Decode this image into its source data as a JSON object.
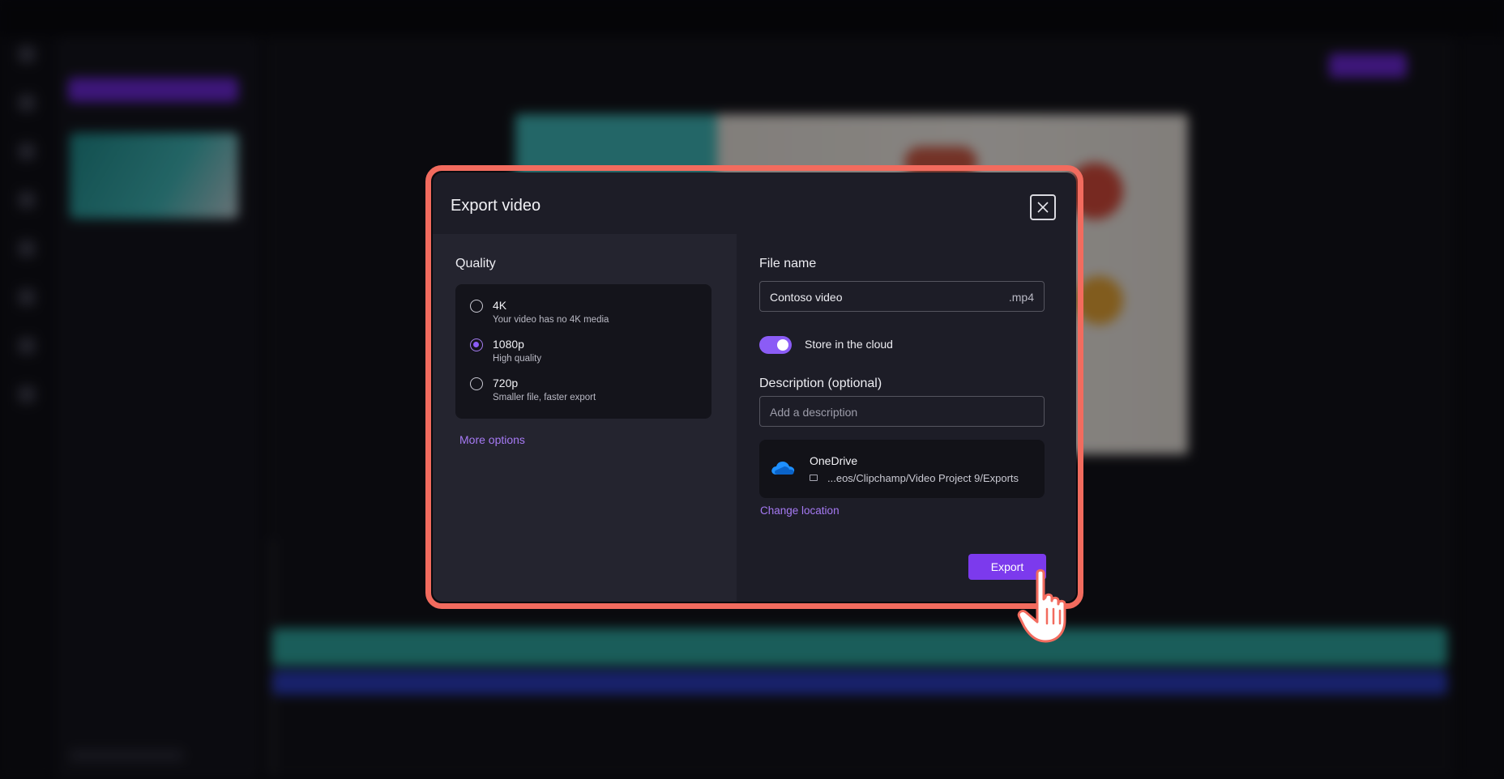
{
  "dialog": {
    "title": "Export video",
    "close_icon": "close-icon"
  },
  "quality": {
    "label": "Quality",
    "selected": "1080p",
    "options": [
      {
        "name": "4K",
        "description": "Your video has no 4K media"
      },
      {
        "name": "1080p",
        "description": "High quality"
      },
      {
        "name": "720p",
        "description": "Smaller file, faster export"
      }
    ],
    "more_options": "More options"
  },
  "file": {
    "label": "File name",
    "value": "Contoso video",
    "extension": ".mp4"
  },
  "cloud_toggle": {
    "label": "Store in the cloud",
    "on": true
  },
  "description": {
    "label": "Description (optional)",
    "placeholder": "Add a description"
  },
  "storage": {
    "provider": "OneDrive",
    "path": "...eos/Clipchamp/Video Project 9/Exports",
    "change_location": "Change location"
  },
  "export_button": "Export",
  "colors": {
    "accent": "#7c3aed",
    "highlight": "#f26b5e",
    "dialog_bg": "#1d1d27"
  }
}
